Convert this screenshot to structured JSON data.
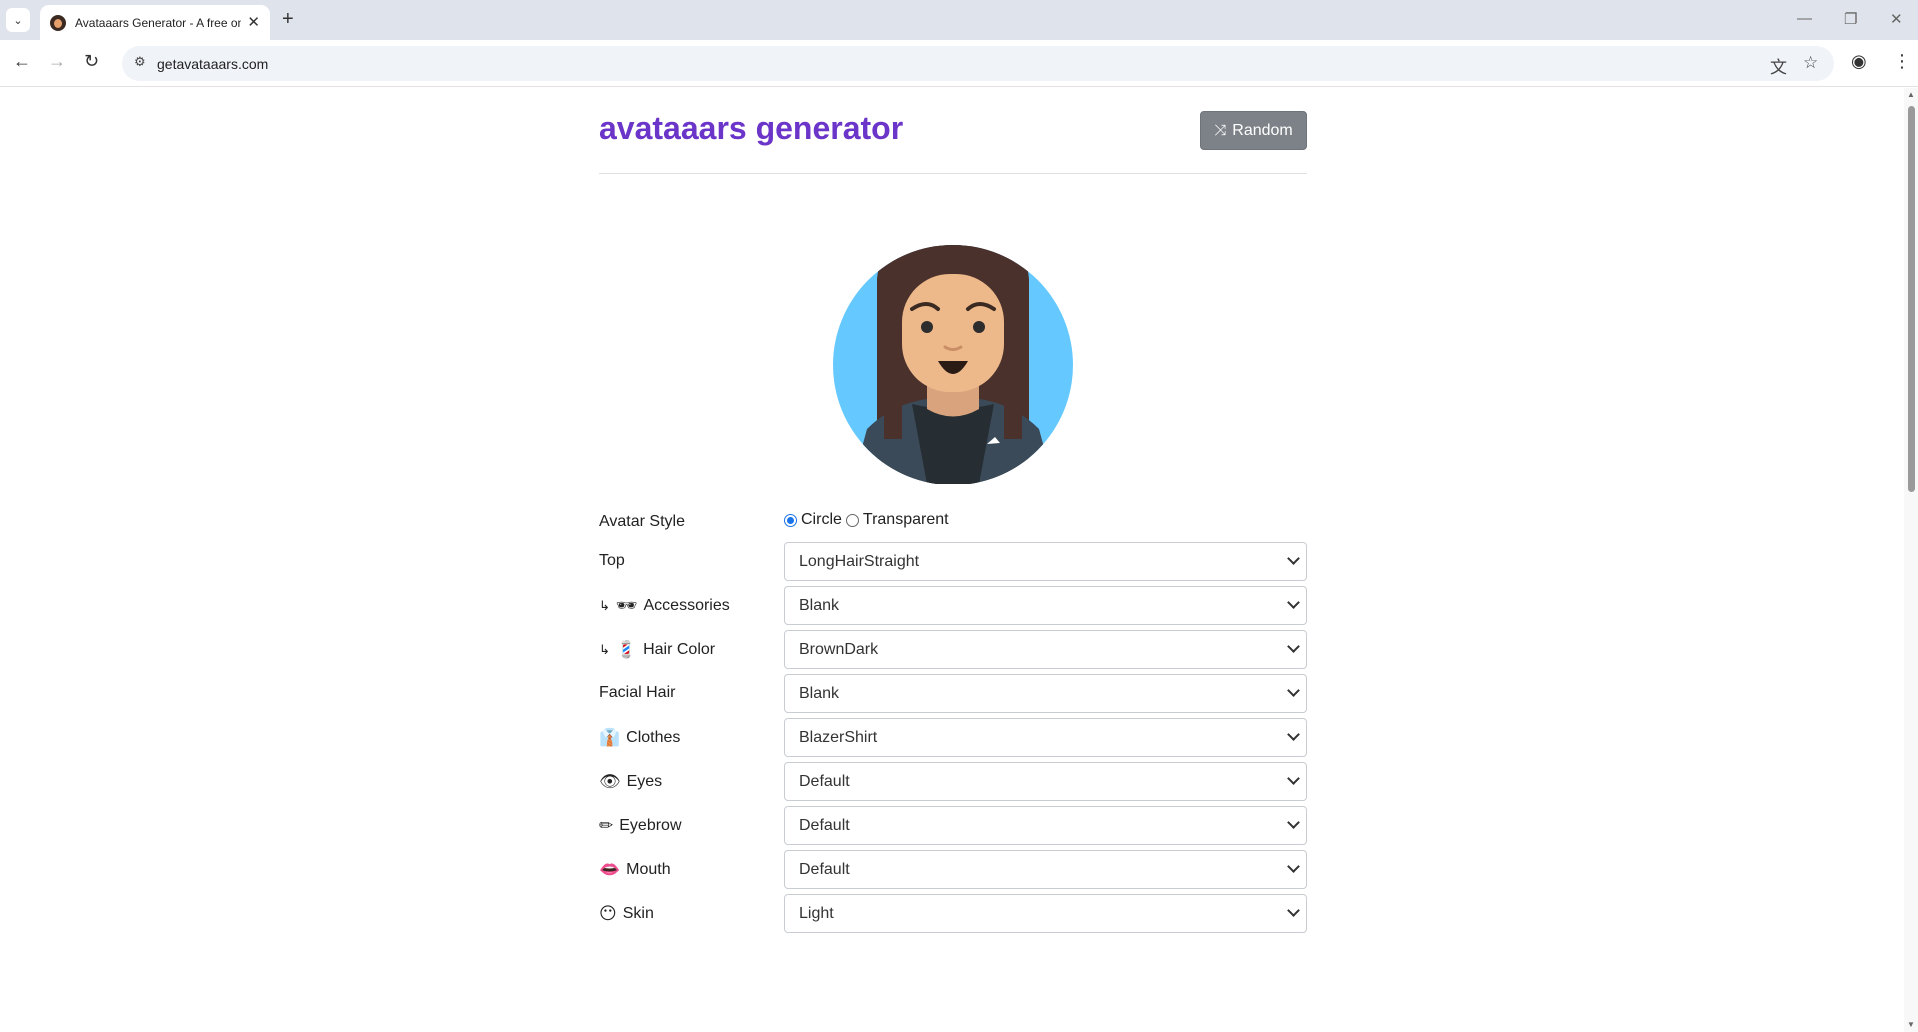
{
  "browser": {
    "tab_title": "Avataaars Generator - A free online avatar generator",
    "url": "getavataaars.com"
  },
  "page": {
    "heading": "avataaars generator",
    "random_label": "Random"
  },
  "avatar_style": {
    "label": "Avatar Style",
    "options": [
      "Circle",
      "Transparent"
    ],
    "selected": "Circle"
  },
  "fields": [
    {
      "label": "Top",
      "value": "LongHairStraight"
    },
    {
      "label": "Accessories",
      "value": "Blank",
      "icon": "glasses-emoji",
      "sub": true
    },
    {
      "label": "Hair Color",
      "value": "BrownDark",
      "icon": "hair-emoji",
      "sub": true
    },
    {
      "label": "Facial Hair",
      "value": "Blank"
    },
    {
      "label": "Clothes",
      "value": "BlazerShirt",
      "icon": "shirt-emoji"
    },
    {
      "label": "Eyes",
      "value": "Default",
      "icon": "eye-emoji"
    },
    {
      "label": "Eyebrow",
      "value": "Default",
      "icon": "pencil-emoji"
    },
    {
      "label": "Mouth",
      "value": "Default",
      "icon": "lips-emoji"
    },
    {
      "label": "Skin",
      "value": "Light",
      "icon": "face-emoji"
    }
  ],
  "colors": {
    "heading": "#6b35c9",
    "random_button": "#7d8288",
    "avatar_bg": "#65c9ff",
    "hair": "#4a312c",
    "skin": "#edb98a",
    "blazer": "#3a4a58"
  }
}
